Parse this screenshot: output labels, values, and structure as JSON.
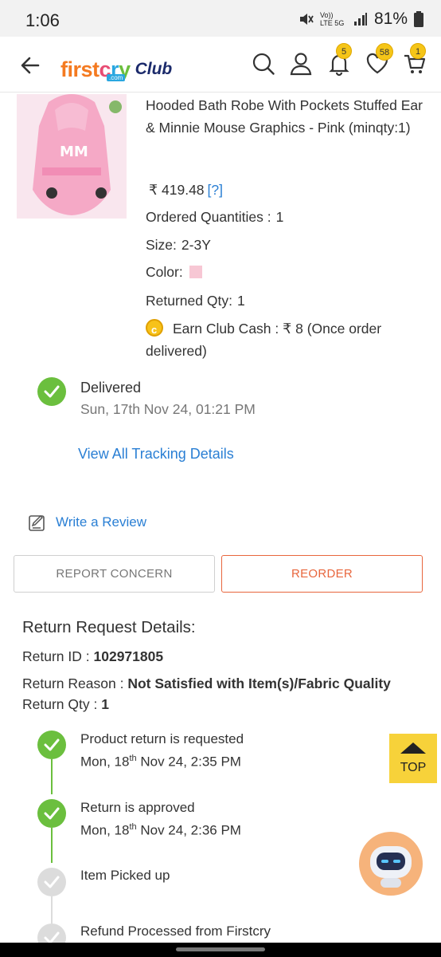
{
  "status_bar": {
    "time": "1:06",
    "battery": "81%",
    "network": "Vo)) LTE 5G"
  },
  "header": {
    "logo_text": "firstcry",
    "logo_com": ".com",
    "club_text": "Club",
    "notification_count": "5",
    "wishlist_count": "58",
    "cart_count": "1"
  },
  "product": {
    "title": "Hooded Bath Robe With Pockets Stuffed Ear & Minnie Mouse Graphics - Pink (minqty:1)",
    "currency": "₹",
    "price": "419.48",
    "price_help": "[?]",
    "ordered_label": "Ordered Quantities :",
    "ordered_value": "1",
    "size_label": "Size:",
    "size_value": "2-3Y",
    "color_label": "Color:",
    "color_swatch": "#f7c7d4",
    "returned_label": "Returned Qty:",
    "returned_value": "1",
    "club_cash_text": "Earn Club Cash : ₹ 8 (Once order delivered)"
  },
  "delivery": {
    "status": "Delivered",
    "date": "Sun, 17th Nov 24, 01:21 PM",
    "tracking_link": "View All Tracking Details"
  },
  "review_link": "Write a Review",
  "buttons": {
    "report": "REPORT CONCERN",
    "reorder": "REORDER"
  },
  "return": {
    "heading": "Return Request Details:",
    "id_label": "Return ID :",
    "id_value": "102971805",
    "reason_label": "Return Reason :",
    "reason_value": "Not Satisfied with Item(s)/Fabric Quality",
    "qty_label": "Return Qty :",
    "qty_value": "1",
    "steps": [
      {
        "title": "Product return is requested",
        "day": "Mon, 18",
        "sup": "th",
        "rest": " Nov 24, 2:35 PM",
        "done": true
      },
      {
        "title": "Return is approved",
        "day": "Mon, 18",
        "sup": "th",
        "rest": " Nov 24, 2:36 PM",
        "done": true
      },
      {
        "title": "Item Picked up",
        "done": false
      },
      {
        "title": "Refund Processed from Firstcry",
        "done": false
      }
    ]
  },
  "top_button": "TOP",
  "colors": {
    "accent_green": "#6bbf3e",
    "link_blue": "#2a7fd4",
    "reorder_orange": "#e8663d",
    "badge_yellow": "#f5c518"
  }
}
